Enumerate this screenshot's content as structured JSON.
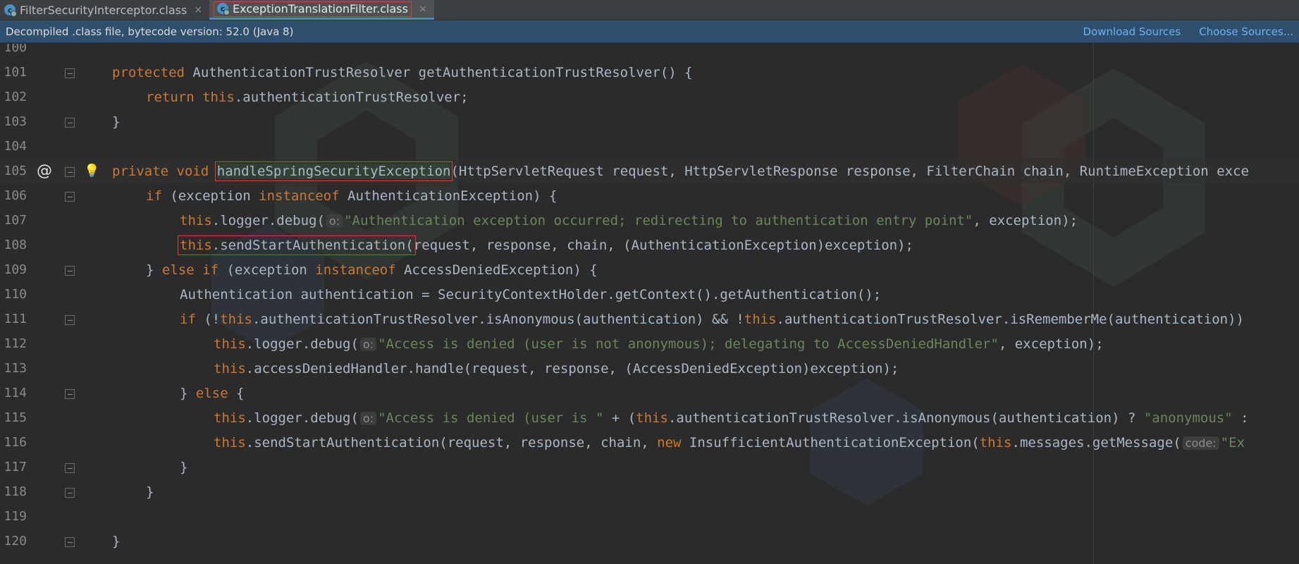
{
  "tabs": [
    {
      "label": "FilterSecurityInterceptor.class",
      "icon": "class-icon",
      "active": false
    },
    {
      "label": "ExceptionTranslationFilter.class",
      "icon": "class-icon",
      "active": true
    }
  ],
  "close_glyph": "×",
  "banner": {
    "text": "Decompiled .class file, bytecode version: 52.0 (Java 8)",
    "download_sources": "Download Sources",
    "choose_sources": "Choose Sources..."
  },
  "gutter": {
    "override_marker": "@"
  },
  "colors": {
    "keyword": "#cc7832",
    "string": "#6a8759",
    "plain": "#a9b7c6",
    "highlight_box": "#e23a3a",
    "banner_bg": "#2f4f6e",
    "link": "#6fb0f0"
  },
  "code_lines": [
    {
      "n": "100",
      "t": ""
    },
    {
      "n": "101",
      "t": "protected AuthenticationTrustResolver getAuthenticationTrustResolver() {"
    },
    {
      "n": "102",
      "t": "return this.authenticationTrustResolver;"
    },
    {
      "n": "103",
      "t": "}"
    },
    {
      "n": "104",
      "t": ""
    },
    {
      "n": "105",
      "t": "private void handleSpringSecurityException(HttpServletRequest request, HttpServletResponse response, FilterChain chain, RuntimeException exce"
    },
    {
      "n": "106",
      "t": "if (exception instanceof AuthenticationException) {"
    },
    {
      "n": "107",
      "t": "this.logger.debug( o: \"Authentication exception occurred; redirecting to authentication entry point\", exception);"
    },
    {
      "n": "108",
      "t": "this.sendStartAuthentication(request, response, chain, (AuthenticationException)exception);"
    },
    {
      "n": "109",
      "t": "} else if (exception instanceof AccessDeniedException) {"
    },
    {
      "n": "110",
      "t": "Authentication authentication = SecurityContextHolder.getContext().getAuthentication();"
    },
    {
      "n": "111",
      "t": "if (!this.authenticationTrustResolver.isAnonymous(authentication) && !this.authenticationTrustResolver.isRememberMe(authentication))"
    },
    {
      "n": "112",
      "t": "this.logger.debug( o: \"Access is denied (user is not anonymous); delegating to AccessDeniedHandler\", exception);"
    },
    {
      "n": "113",
      "t": "this.accessDeniedHandler.handle(request, response, (AccessDeniedException)exception);"
    },
    {
      "n": "114",
      "t": "} else {"
    },
    {
      "n": "115",
      "t": "this.logger.debug( o: \"Access is denied (user is \" + (this.authenticationTrustResolver.isAnonymous(authentication) ? \"anonymous\" :"
    },
    {
      "n": "116",
      "t": "this.sendStartAuthentication(request, response, chain, new InsufficientAuthenticationException(this.messages.getMessage( code: \"Ex"
    },
    {
      "n": "117",
      "t": "}"
    },
    {
      "n": "118",
      "t": "}"
    },
    {
      "n": "119",
      "t": ""
    },
    {
      "n": "120",
      "t": "}"
    }
  ],
  "tokens": {
    "l101": {
      "kw1": "protected",
      "rest": " AuthenticationTrustResolver getAuthenticationTrustResolver() {"
    },
    "l102": {
      "kw1": "return",
      "kw2": "this",
      "rest": ".authenticationTrustResolver;"
    },
    "l105": {
      "kw1": "private",
      "kw2": "void",
      "method": "handleSpringSecurityException",
      "rest": "(HttpServletRequest request, HttpServletResponse response, FilterChain chain, RuntimeException exce"
    },
    "l106": {
      "kw1": "if",
      "p1": " (exception ",
      "kw2": "instanceof",
      "rest": " AuthenticationException) {"
    },
    "l107": {
      "kw1": "this",
      "p1": ".logger.debug(",
      "hint": "o:",
      "str": "\"Authentication exception occurred; redirecting to authentication entry point\"",
      "rest": ", exception);"
    },
    "l108": {
      "kw1": "this",
      "call": ".sendStartAuthentication(",
      "rest": "request, response, chain, (AuthenticationException)exception);"
    },
    "l109": {
      "p0": "} ",
      "kw1": "else",
      "kw2": "if",
      "p1": " (exception ",
      "kw3": "instanceof",
      "rest": " AccessDeniedException) {"
    },
    "l110": {
      "rest": "Authentication authentication = SecurityContextHolder.getContext().getAuthentication();"
    },
    "l111": {
      "kw1": "if",
      "p1": " (!",
      "kw2": "this",
      "p2": ".authenticationTrustResolver.isAnonymous(authentication) && !",
      "kw3": "this",
      "rest": ".authenticationTrustResolver.isRememberMe(authentication))"
    },
    "l112": {
      "kw1": "this",
      "p1": ".logger.debug(",
      "hint": "o:",
      "str": "\"Access is denied (user is not anonymous); delegating to AccessDeniedHandler\"",
      "rest": ", exception);"
    },
    "l113": {
      "kw1": "this",
      "rest": ".accessDeniedHandler.handle(request, response, (AccessDeniedException)exception);"
    },
    "l114": {
      "p0": "} ",
      "kw1": "else",
      "rest": " {"
    },
    "l115": {
      "kw1": "this",
      "p1": ".logger.debug(",
      "hint": "o:",
      "str": "\"Access is denied (user is \"",
      "p2": " + (",
      "kw2": "this",
      "p3": ".authenticationTrustResolver.isAnonymous(authentication) ? ",
      "str2": "\"anonymous\"",
      "rest": " :"
    },
    "l116": {
      "kw1": "this",
      "p1": ".sendStartAuthentication(request, response, chain, ",
      "kw2": "new",
      "p2": " InsufficientAuthenticationException(",
      "kw3": "this",
      "p3": ".messages.getMessage(",
      "hint": "code:",
      "str": "\"Ex"
    },
    "brace": "}"
  }
}
